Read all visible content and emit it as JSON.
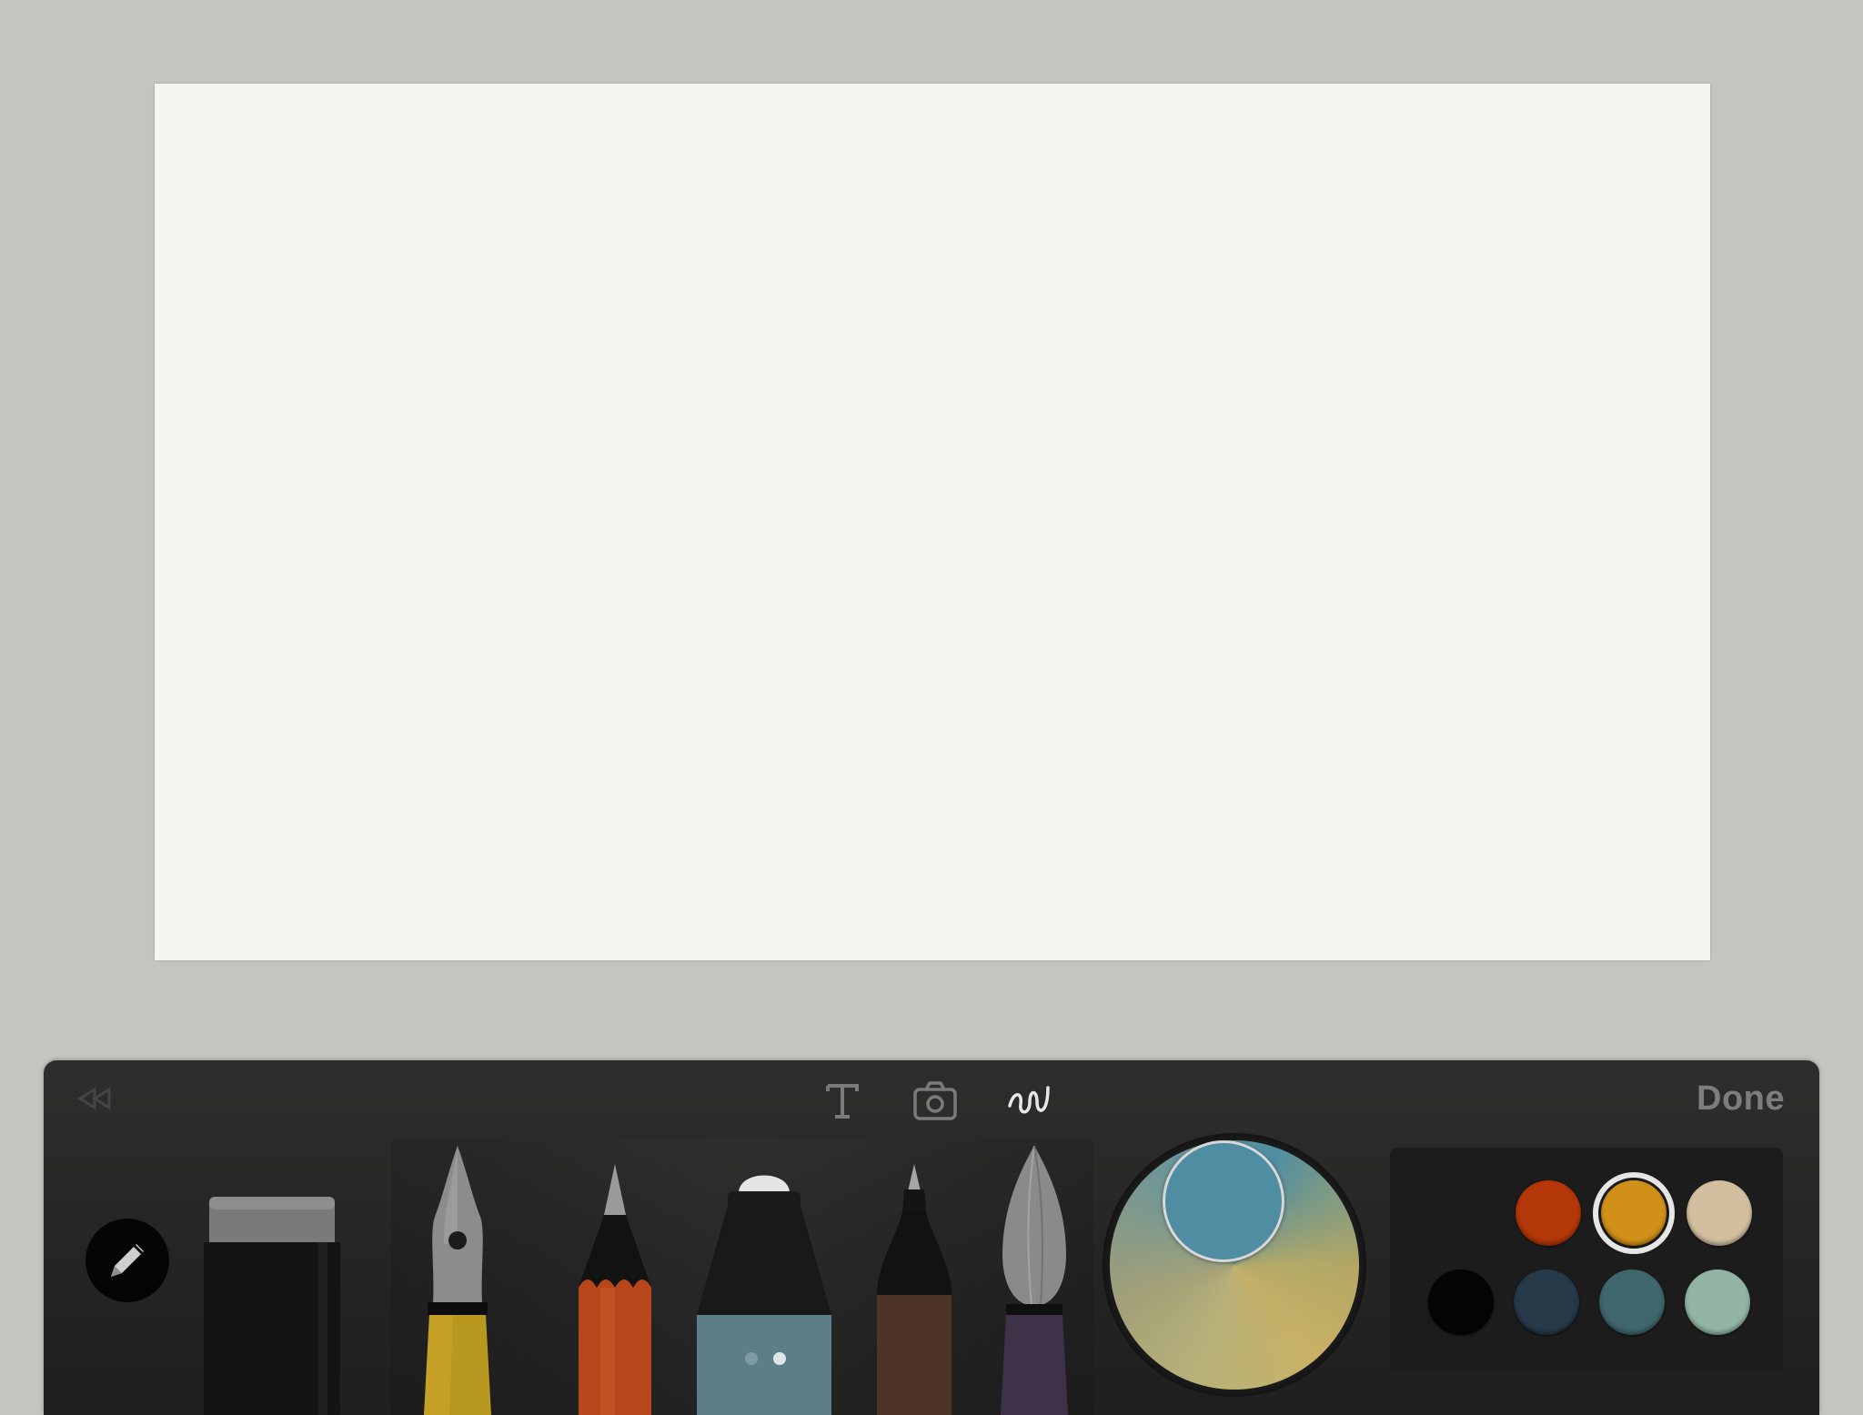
{
  "toolbar": {
    "done_label": "Done",
    "modes": [
      {
        "name": "text",
        "icon": "text-T-icon",
        "active": false
      },
      {
        "name": "photo",
        "icon": "camera-icon",
        "active": false
      },
      {
        "name": "draw",
        "icon": "squiggle-icon",
        "active": true
      }
    ],
    "tools": [
      "eraser",
      "fountain-pen",
      "pencil",
      "marker",
      "fineliner",
      "watercolor-brush"
    ]
  },
  "colors": {
    "current": "#4f8da2",
    "palette": [
      {
        "hex": "#b33708",
        "selected": false
      },
      {
        "hex": "#d19118",
        "selected": true
      },
      {
        "hex": "#d2bfa0",
        "selected": false
      },
      {
        "hex": "#050505",
        "selected": false
      },
      {
        "hex": "#263a49",
        "selected": false
      },
      {
        "hex": "#3f676d",
        "selected": false
      },
      {
        "hex": "#93b5a5",
        "selected": false
      }
    ]
  }
}
